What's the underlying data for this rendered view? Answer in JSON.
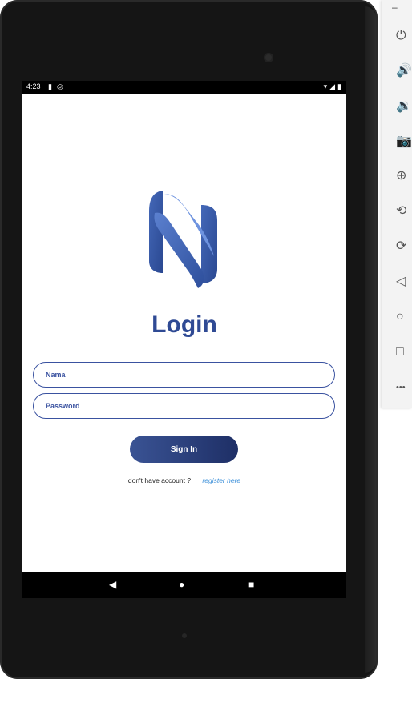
{
  "status_bar": {
    "time": "4:23",
    "left_icons": [
      "sd-card-icon",
      "sync-icon"
    ],
    "right_icons": [
      "wifi-icon",
      "signal-icon",
      "battery-icon"
    ]
  },
  "login": {
    "title": "Login",
    "name_placeholder": "Nama",
    "password_placeholder": "Password",
    "signin_label": "Sign In",
    "no_account_text": "don't have account ?",
    "register_link": "register here"
  },
  "colors": {
    "primary": "#2f4a94",
    "button_start": "#3a5394",
    "button_end": "#1e2f66",
    "link": "#3b8fd9"
  },
  "nav_bar": {
    "back": "◀",
    "home": "●",
    "recent": "■"
  },
  "emulator_toolbar": {
    "minimize": "–",
    "items": [
      {
        "name": "power-icon",
        "glyph": "⏻"
      },
      {
        "name": "volume-up-icon",
        "glyph": "🔊"
      },
      {
        "name": "volume-down-icon",
        "glyph": "🔉"
      },
      {
        "name": "camera-icon",
        "glyph": "📷"
      },
      {
        "name": "zoom-icon",
        "glyph": "⊕"
      },
      {
        "name": "rotate-left-icon",
        "glyph": "⟲"
      },
      {
        "name": "rotate-right-icon",
        "glyph": "⟳"
      },
      {
        "name": "back-icon",
        "glyph": "◁"
      },
      {
        "name": "home-icon",
        "glyph": "○"
      },
      {
        "name": "overview-icon",
        "glyph": "□"
      },
      {
        "name": "more-icon",
        "glyph": "•••"
      }
    ]
  }
}
